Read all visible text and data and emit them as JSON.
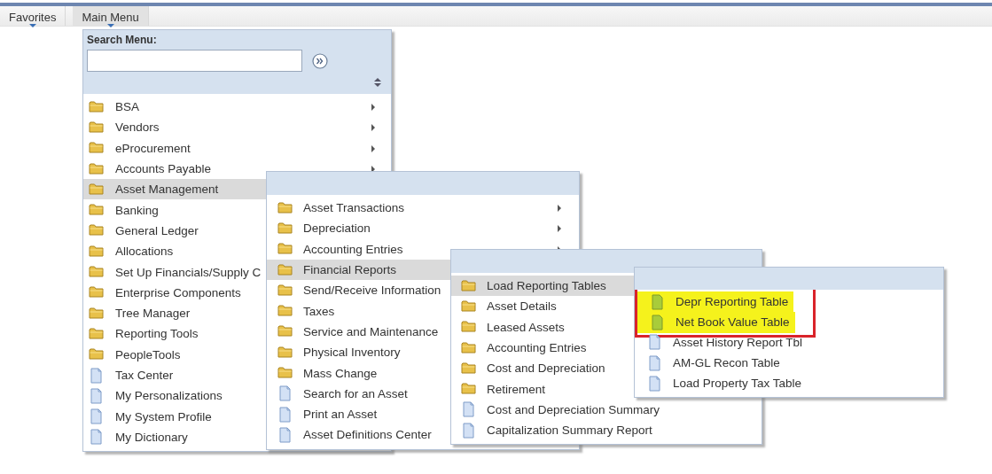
{
  "nav_tabs": [
    {
      "label": "Favorites",
      "selected": false
    },
    {
      "label": "Main Menu",
      "selected": true
    }
  ],
  "search": {
    "label": "Search Menu:"
  },
  "menus": [
    {
      "items": [
        {
          "label": "BSA",
          "kind": "folder",
          "has_submenu": true,
          "selected": false
        },
        {
          "label": "Vendors",
          "kind": "folder",
          "has_submenu": true,
          "selected": false
        },
        {
          "label": "eProcurement",
          "kind": "folder",
          "has_submenu": true,
          "selected": false
        },
        {
          "label": "Accounts Payable",
          "kind": "folder",
          "has_submenu": true,
          "selected": false
        },
        {
          "label": "Asset Management",
          "kind": "folder",
          "has_submenu": false,
          "selected": true
        },
        {
          "label": "Banking",
          "kind": "folder",
          "has_submenu": false,
          "selected": false
        },
        {
          "label": "General Ledger",
          "kind": "folder",
          "has_submenu": false,
          "selected": false
        },
        {
          "label": "Allocations",
          "kind": "folder",
          "has_submenu": false,
          "selected": false
        },
        {
          "label": "Set Up Financials/Supply C",
          "kind": "folder",
          "has_submenu": false,
          "selected": false
        },
        {
          "label": "Enterprise Components",
          "kind": "folder",
          "has_submenu": false,
          "selected": false
        },
        {
          "label": "Tree Manager",
          "kind": "folder",
          "has_submenu": false,
          "selected": false
        },
        {
          "label": "Reporting Tools",
          "kind": "folder",
          "has_submenu": false,
          "selected": false
        },
        {
          "label": "PeopleTools",
          "kind": "folder",
          "has_submenu": false,
          "selected": false
        },
        {
          "label": "Tax Center",
          "kind": "page",
          "has_submenu": false,
          "selected": false
        },
        {
          "label": "My Personalizations",
          "kind": "page",
          "has_submenu": false,
          "selected": false
        },
        {
          "label": "My System Profile",
          "kind": "page",
          "has_submenu": false,
          "selected": false
        },
        {
          "label": "My Dictionary",
          "kind": "page",
          "has_submenu": false,
          "selected": false
        }
      ]
    },
    {
      "items": [
        {
          "label": "Asset Transactions",
          "kind": "folder",
          "has_submenu": true,
          "selected": false
        },
        {
          "label": "Depreciation",
          "kind": "folder",
          "has_submenu": true,
          "selected": false
        },
        {
          "label": "Accounting Entries",
          "kind": "folder",
          "has_submenu": true,
          "selected": false
        },
        {
          "label": "Financial Reports",
          "kind": "folder",
          "has_submenu": false,
          "selected": true
        },
        {
          "label": "Send/Receive Information",
          "kind": "folder",
          "has_submenu": false,
          "selected": false
        },
        {
          "label": "Taxes",
          "kind": "folder",
          "has_submenu": false,
          "selected": false
        },
        {
          "label": "Service and Maintenance",
          "kind": "folder",
          "has_submenu": false,
          "selected": false
        },
        {
          "label": "Physical Inventory",
          "kind": "folder",
          "has_submenu": false,
          "selected": false
        },
        {
          "label": "Mass Change",
          "kind": "folder",
          "has_submenu": false,
          "selected": false
        },
        {
          "label": "Search for an Asset",
          "kind": "page",
          "has_submenu": false,
          "selected": false
        },
        {
          "label": "Print an Asset",
          "kind": "page",
          "has_submenu": false,
          "selected": false
        },
        {
          "label": "Asset Definitions Center",
          "kind": "page",
          "has_submenu": false,
          "selected": false
        }
      ]
    },
    {
      "items": [
        {
          "label": "Load Reporting Tables",
          "kind": "folder",
          "has_submenu": false,
          "selected": true
        },
        {
          "label": "Asset Details",
          "kind": "folder",
          "has_submenu": false,
          "selected": false
        },
        {
          "label": "Leased Assets",
          "kind": "folder",
          "has_submenu": false,
          "selected": false
        },
        {
          "label": "Accounting Entries",
          "kind": "folder",
          "has_submenu": false,
          "selected": false
        },
        {
          "label": "Cost and Depreciation",
          "kind": "folder",
          "has_submenu": false,
          "selected": false
        },
        {
          "label": "Retirement",
          "kind": "folder",
          "has_submenu": false,
          "selected": false
        },
        {
          "label": "Cost and Depreciation Summary",
          "kind": "page",
          "has_submenu": false,
          "selected": false
        },
        {
          "label": "Capitalization Summary Report",
          "kind": "page",
          "has_submenu": false,
          "selected": false
        }
      ]
    },
    {
      "items": [
        {
          "label": "Depr Reporting Table",
          "kind": "page",
          "has_submenu": false,
          "selected": false,
          "highlighted": true
        },
        {
          "label": "Net Book Value Table",
          "kind": "page",
          "has_submenu": false,
          "selected": false,
          "highlighted": true
        },
        {
          "label": "Asset History Report Tbl",
          "kind": "page",
          "has_submenu": false,
          "selected": false,
          "highlighted": false
        },
        {
          "label": "AM-GL Recon Table",
          "kind": "page",
          "has_submenu": false,
          "selected": false,
          "highlighted": false
        },
        {
          "label": "Load Property Tax Table",
          "kind": "page",
          "has_submenu": false,
          "selected": false,
          "highlighted": false
        }
      ]
    }
  ]
}
